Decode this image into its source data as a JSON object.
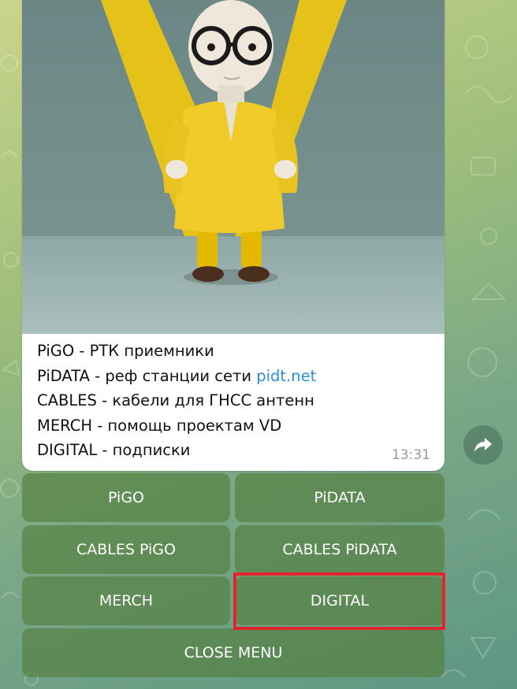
{
  "message": {
    "caption_lines": [
      "PiGO - РТК приемники",
      "PiDATA - реф станции сети ",
      "CABLES - кабели для ГНСС антенн",
      "MERCH - помощь проектам VD",
      "DIGITAL - подписки"
    ],
    "link_text": "pidt.net",
    "time": "13:31"
  },
  "keyboard": {
    "pigo": "PiGO",
    "pidata": "PiDATA",
    "cables_pigo": "CABLES PiGO",
    "cables_pidata": "CABLES PiDATA",
    "merch": "MERCH",
    "digital": "DIGITAL",
    "close": "CLOSE MENU"
  },
  "colors": {
    "keyboard_button": "#568042",
    "highlight": "#e0252d",
    "link": "#2a8fd6"
  },
  "icons": {
    "share": "share-arrow-icon"
  }
}
